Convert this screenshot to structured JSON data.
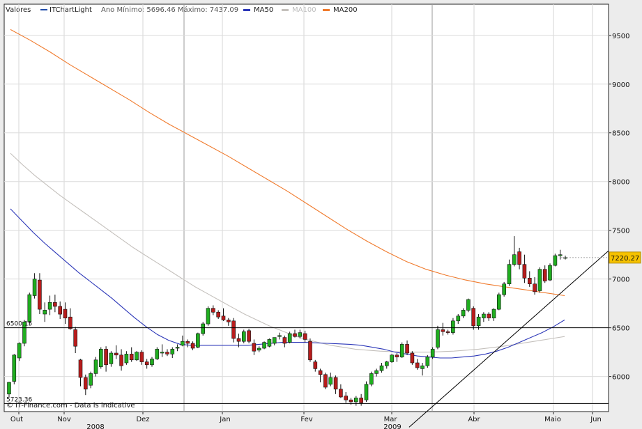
{
  "legend": {
    "label": "Valores",
    "series_name": "ITChartLight",
    "range_text": "Ano Mínimo: 5696.46 Máximo: 7437.09",
    "ma50": "MA50",
    "ma100": "MA100",
    "ma200": "MA200"
  },
  "footer": "© IT-Finance.com - Data is indicative",
  "last_price": "7220.27",
  "levels": [
    {
      "label": "6500.15",
      "value": 6500.15
    },
    {
      "label": "5723.36",
      "value": 5723.36
    }
  ],
  "colors": {
    "up": "#1fae1f",
    "down": "#b81c1c",
    "ma50": "#2b36b8",
    "ma100": "#c4c0bc",
    "ma200": "#f07a2c",
    "trend": "#000000",
    "price_badge": "#f6c200"
  },
  "chart_data": {
    "type": "candlestick",
    "y_range": [
      5640,
      9820
    ],
    "y_ticks": [
      6000,
      6500,
      7000,
      7500,
      8000,
      8500,
      9000,
      9500
    ],
    "x_months": [
      "Out",
      "Nov",
      "Dez",
      "Jan",
      "Fev",
      "Mar",
      "Abr",
      "Maio",
      "Jun"
    ],
    "x_years": [
      "2008",
      "2009"
    ],
    "candles_ohlc": [
      [
        5820,
        5945,
        5785,
        5940
      ],
      [
        5950,
        6230,
        5920,
        6220
      ],
      [
        6190,
        6350,
        6160,
        6340
      ],
      [
        6340,
        6580,
        6310,
        6560
      ],
      [
        6560,
        6860,
        6530,
        6840
      ],
      [
        6830,
        7060,
        6800,
        7000
      ],
      [
        6990,
        7060,
        6640,
        6690
      ],
      [
        6640,
        6760,
        6560,
        6680
      ],
      [
        6690,
        6830,
        6630,
        6760
      ],
      [
        6760,
        6840,
        6660,
        6720
      ],
      [
        6720,
        6770,
        6590,
        6640
      ],
      [
        6690,
        6760,
        6540,
        6600
      ],
      [
        6610,
        6700,
        6480,
        6490
      ],
      [
        6480,
        6510,
        6240,
        6310
      ],
      [
        6170,
        6180,
        5900,
        5990
      ],
      [
        5990,
        6020,
        5810,
        5870
      ],
      [
        5910,
        6050,
        5880,
        6030
      ],
      [
        6030,
        6200,
        6000,
        6170
      ],
      [
        6100,
        6300,
        6080,
        6280
      ],
      [
        6280,
        6310,
        6050,
        6120
      ],
      [
        6130,
        6260,
        6100,
        6240
      ],
      [
        6240,
        6320,
        6180,
        6220
      ],
      [
        6220,
        6280,
        6060,
        6110
      ],
      [
        6140,
        6260,
        6120,
        6230
      ],
      [
        6230,
        6300,
        6150,
        6170
      ],
      [
        6170,
        6260,
        6160,
        6250
      ],
      [
        6250,
        6270,
        6120,
        6150
      ],
      [
        6150,
        6180,
        6080,
        6120
      ],
      [
        6120,
        6200,
        6100,
        6180
      ],
      [
        6180,
        6300,
        6170,
        6280
      ],
      [
        6240,
        6330,
        6200,
        6250
      ],
      [
        6250,
        6280,
        6210,
        6230
      ],
      [
        6230,
        6300,
        6190,
        6280
      ],
      [
        6290,
        6330,
        6260,
        6300
      ],
      [
        6320,
        6420,
        6310,
        6360
      ],
      [
        6360,
        6380,
        6300,
        6340
      ],
      [
        6340,
        6360,
        6270,
        6290
      ],
      [
        6300,
        6450,
        6290,
        6440
      ],
      [
        6440,
        6560,
        6420,
        6540
      ],
      [
        6540,
        6720,
        6520,
        6700
      ],
      [
        6700,
        6730,
        6630,
        6660
      ],
      [
        6660,
        6680,
        6590,
        6610
      ],
      [
        6620,
        6700,
        6570,
        6580
      ],
      [
        6580,
        6600,
        6520,
        6560
      ],
      [
        6570,
        6600,
        6350,
        6390
      ],
      [
        6390,
        6440,
        6300,
        6360
      ],
      [
        6360,
        6480,
        6340,
        6460
      ],
      [
        6470,
        6490,
        6340,
        6360
      ],
      [
        6340,
        6380,
        6220,
        6260
      ],
      [
        6270,
        6310,
        6250,
        6290
      ],
      [
        6290,
        6360,
        6280,
        6350
      ],
      [
        6310,
        6390,
        6300,
        6380
      ],
      [
        6340,
        6400,
        6320,
        6400
      ],
      [
        6410,
        6450,
        6380,
        6420
      ],
      [
        6400,
        6420,
        6300,
        6340
      ],
      [
        6350,
        6460,
        6340,
        6440
      ],
      [
        6440,
        6480,
        6400,
        6410
      ],
      [
        6410,
        6480,
        6390,
        6450
      ],
      [
        6440,
        6470,
        6350,
        6380
      ],
      [
        6360,
        6390,
        6150,
        6170
      ],
      [
        6150,
        6170,
        6050,
        6080
      ],
      [
        6060,
        6080,
        5940,
        6020
      ],
      [
        6020,
        6040,
        5870,
        5890
      ],
      [
        5920,
        6040,
        5900,
        5990
      ],
      [
        5990,
        6010,
        5820,
        5870
      ],
      [
        5870,
        5920,
        5780,
        5790
      ],
      [
        5800,
        5840,
        5730,
        5760
      ],
      [
        5760,
        5780,
        5710,
        5740
      ],
      [
        5740,
        5800,
        5700,
        5780
      ],
      [
        5780,
        5820,
        5700,
        5730
      ],
      [
        5760,
        5950,
        5740,
        5920
      ],
      [
        5920,
        6050,
        5900,
        6030
      ],
      [
        6030,
        6080,
        6000,
        6060
      ],
      [
        6060,
        6140,
        6040,
        6110
      ],
      [
        6110,
        6160,
        6080,
        6150
      ],
      [
        6150,
        6230,
        6140,
        6220
      ],
      [
        6220,
        6240,
        6150,
        6200
      ],
      [
        6200,
        6350,
        6190,
        6330
      ],
      [
        6330,
        6370,
        6220,
        6240
      ],
      [
        6240,
        6260,
        6120,
        6140
      ],
      [
        6140,
        6180,
        6070,
        6090
      ],
      [
        6080,
        6140,
        6010,
        6110
      ],
      [
        6110,
        6220,
        6090,
        6200
      ],
      [
        6200,
        6300,
        6180,
        6280
      ],
      [
        6300,
        6520,
        6280,
        6480
      ],
      [
        6480,
        6550,
        6420,
        6460
      ],
      [
        6460,
        6480,
        6430,
        6450
      ],
      [
        6450,
        6600,
        6430,
        6570
      ],
      [
        6570,
        6640,
        6540,
        6620
      ],
      [
        6620,
        6700,
        6600,
        6680
      ],
      [
        6680,
        6800,
        6660,
        6790
      ],
      [
        6700,
        6720,
        6480,
        6520
      ],
      [
        6520,
        6640,
        6480,
        6610
      ],
      [
        6600,
        6660,
        6560,
        6640
      ],
      [
        6640,
        6660,
        6570,
        6600
      ],
      [
        6600,
        6700,
        6570,
        6690
      ],
      [
        6690,
        6860,
        6680,
        6840
      ],
      [
        6840,
        6970,
        6820,
        6950
      ],
      [
        6950,
        7200,
        6930,
        7150
      ],
      [
        7150,
        7440,
        7130,
        7250
      ],
      [
        7280,
        7320,
        7100,
        7150
      ],
      [
        7150,
        7250,
        6960,
        7010
      ],
      [
        7010,
        7080,
        6920,
        6950
      ],
      [
        6950,
        7020,
        6840,
        6870
      ],
      [
        6880,
        7120,
        6860,
        7100
      ],
      [
        7100,
        7140,
        6960,
        6980
      ],
      [
        6990,
        7160,
        6980,
        7140
      ],
      [
        7140,
        7260,
        7130,
        7240
      ],
      [
        7240,
        7300,
        7200,
        7250
      ],
      [
        7220,
        7240,
        7200,
        7220
      ]
    ],
    "ma50": [
      7720,
      7600,
      7480,
      7370,
      7270,
      7170,
      7070,
      6980,
      6890,
      6800,
      6700,
      6600,
      6510,
      6430,
      6370,
      6330,
      6320,
      6320,
      6320,
      6320,
      6320,
      6320,
      6330,
      6340,
      6350,
      6350,
      6350,
      6345,
      6340,
      6335,
      6330,
      6320,
      6300,
      6280,
      6250,
      6230,
      6210,
      6200,
      6190,
      6190,
      6200,
      6210,
      6230,
      6260,
      6300,
      6350,
      6400,
      6450,
      6510,
      6580
    ],
    "ma100": [
      8290,
      8170,
      8060,
      7960,
      7860,
      7770,
      7680,
      7590,
      7500,
      7410,
      7320,
      7240,
      7160,
      7080,
      7000,
      6920,
      6850,
      6780,
      6710,
      6640,
      6580,
      6520,
      6470,
      6420,
      6380,
      6350,
      6320,
      6300,
      6280,
      6270,
      6260,
      6255,
      6250,
      6250,
      6250,
      6255,
      6260,
      6270,
      6280,
      6295,
      6310,
      6330,
      6350,
      6370,
      6390,
      6410
    ],
    "ma200": [
      9560,
      9450,
      9330,
      9200,
      9080,
      8960,
      8840,
      8710,
      8590,
      8480,
      8370,
      8260,
      8140,
      8020,
      7900,
      7770,
      7640,
      7510,
      7390,
      7280,
      7180,
      7100,
      7040,
      6990,
      6950,
      6920,
      6890,
      6860,
      6830
    ],
    "trendline": [
      [
        0.67,
        5480
      ],
      [
        1.0,
        7290
      ]
    ]
  }
}
